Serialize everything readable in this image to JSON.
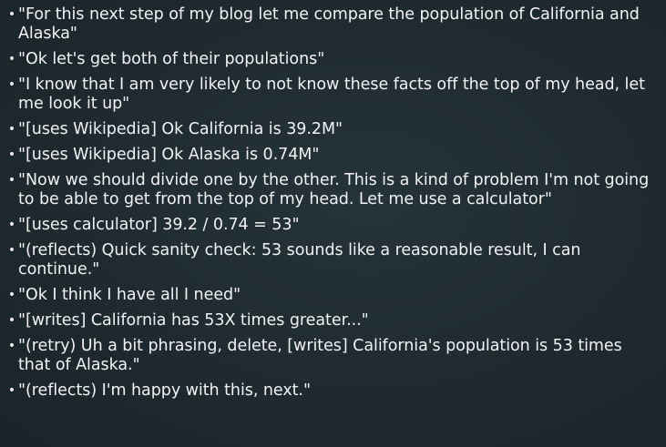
{
  "bullets": [
    "\"For this next step of my blog let me compare the population of California and Alaska\"",
    "\"Ok let's get both of their populations\"",
    "\"I know that I am very likely to not know these facts off the top of my head, let me look it up\"",
    "\"[uses Wikipedia] Ok California is 39.2M\"",
    "\"[uses Wikipedia] Ok Alaska is 0.74M\"",
    "\"Now we should divide one by the other. This is a kind of problem I'm not going to be able to get from the top of my head. Let me use a calculator\"",
    "\"[uses calculator] 39.2 / 0.74 = 53\"",
    "\"(reflects) Quick sanity check: 53 sounds like a reasonable result, I can continue.\"",
    "\"Ok I think I have all I need\"",
    "\"[writes] California has 53X times greater...\"",
    "\"(retry) Uh a bit phrasing, delete, [writes] California's population is 53 times that of Alaska.\"",
    "\"(reflects) I'm happy with this, next.\""
  ]
}
